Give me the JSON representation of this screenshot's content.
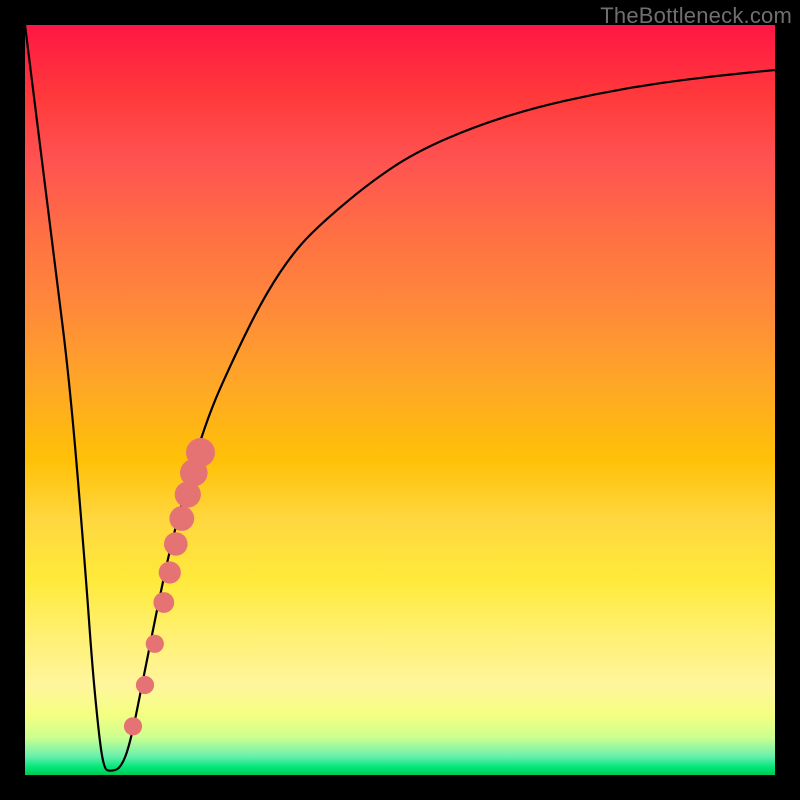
{
  "watermark": "TheBottleneck.com",
  "colors": {
    "frame": "#000000",
    "curve": "#000000",
    "dot_fill": "#e57373",
    "dot_stroke": "#c85a5a"
  },
  "chart_data": {
    "type": "line",
    "title": "",
    "xlabel": "",
    "ylabel": "",
    "xlim": [
      0,
      100
    ],
    "ylim": [
      0,
      100
    ],
    "grid": false,
    "legend": false,
    "series": [
      {
        "name": "bottleneck-curve",
        "x": [
          0,
          2,
          4,
          6,
          8,
          9,
          10,
          10.6,
          11.3,
          12.7,
          14,
          16,
          18,
          20,
          24,
          28,
          32,
          36,
          40,
          46,
          52,
          60,
          68,
          76,
          84,
          92,
          100
        ],
        "y": [
          100,
          84,
          68,
          52,
          28,
          14,
          4,
          0.8,
          0.5,
          0.8,
          4,
          14,
          24,
          33,
          47,
          56,
          64,
          70,
          74,
          79,
          83,
          86.5,
          89,
          90.8,
          92.2,
          93.2,
          94
        ]
      }
    ],
    "dots": [
      {
        "x": 14.4,
        "y": 6.5,
        "r": 0.9
      },
      {
        "x": 16.0,
        "y": 12.0,
        "r": 0.9
      },
      {
        "x": 17.3,
        "y": 17.5,
        "r": 0.9
      },
      {
        "x": 18.5,
        "y": 23.0,
        "r": 1.1
      },
      {
        "x": 19.3,
        "y": 27.0,
        "r": 1.2
      },
      {
        "x": 20.1,
        "y": 30.8,
        "r": 1.3
      },
      {
        "x": 20.9,
        "y": 34.2,
        "r": 1.4
      },
      {
        "x": 21.7,
        "y": 37.4,
        "r": 1.5
      },
      {
        "x": 22.5,
        "y": 40.3,
        "r": 1.6
      },
      {
        "x": 23.4,
        "y": 43.0,
        "r": 1.7
      }
    ]
  }
}
